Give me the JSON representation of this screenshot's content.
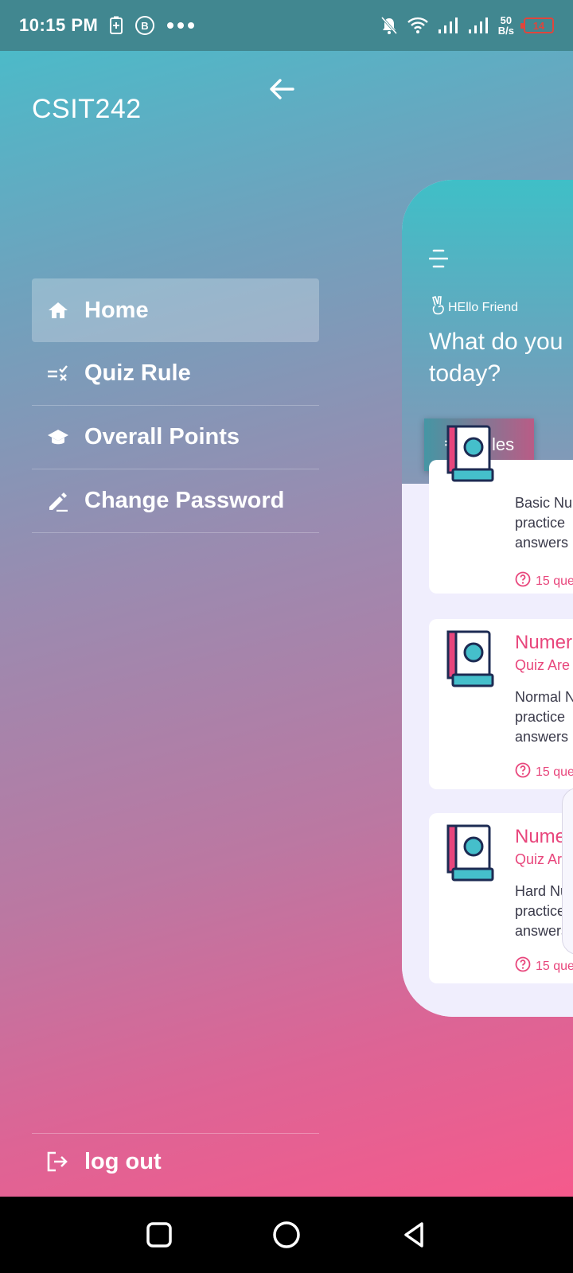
{
  "status_bar": {
    "time": "10:15 PM",
    "network_speed_value": "50",
    "network_speed_unit": "B/s",
    "battery_level": "14",
    "icons": [
      "battery-saver-icon",
      "whatsapp-business-icon",
      "more-dots-icon",
      "mute-bell-icon",
      "wifi-icon",
      "signal-icon",
      "signal-icon-2"
    ]
  },
  "drawer": {
    "title": "CSIT242",
    "back_icon": "arrow-left-icon",
    "items": [
      {
        "label": "Home",
        "icon": "home-icon",
        "active": true
      },
      {
        "label": "Quiz Rule",
        "icon": "rule-icon",
        "active": false
      },
      {
        "label": "Overall Points",
        "icon": "graduation-cap-icon",
        "active": false
      },
      {
        "label": "Change Password",
        "icon": "edit-pencil-icon",
        "active": false
      }
    ],
    "logout_label": "log out",
    "logout_icon": "logout-icon"
  },
  "main": {
    "menu_icon": "hamburger-icon",
    "greeting": "HEllo Friend",
    "headline_line1": "What do you",
    "headline_line2": "today?",
    "rules_button": "Rules",
    "cards": [
      {
        "title": "",
        "subtitle": "",
        "desc1": "Basic Nu",
        "desc2": "practice",
        "desc3": "answers",
        "footer": "15 que"
      },
      {
        "title": "Numer",
        "subtitle": "Quiz Are",
        "desc1": "Normal N",
        "desc2": "practice",
        "desc3": "answers",
        "footer": "15 que"
      },
      {
        "title": "Numer",
        "subtitle": "Quiz Are",
        "desc1": "Hard Nu",
        "desc2": "practice",
        "desc3": "answers",
        "footer": "15 que"
      }
    ]
  },
  "colors": {
    "accent_pink": "#e8467c",
    "teal": "#45bfcb",
    "status_bar": "#418790"
  }
}
